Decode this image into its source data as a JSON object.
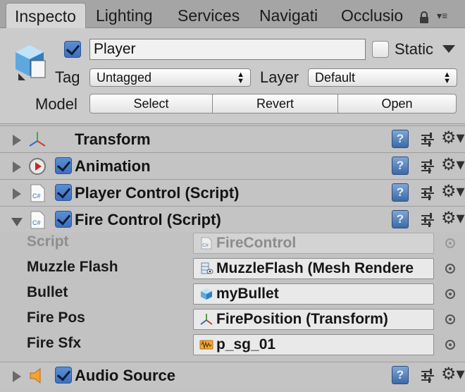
{
  "tabs": [
    {
      "label": "Inspecto",
      "active": true
    },
    {
      "label": "Lighting",
      "active": false
    },
    {
      "label": "Services",
      "active": false
    },
    {
      "label": "Navigati",
      "active": false
    },
    {
      "label": "Occlusio",
      "active": false
    }
  ],
  "header": {
    "active_checked": true,
    "name_value": "Player",
    "static_label": "Static",
    "static_checked": false,
    "tag_label": "Tag",
    "tag_value": "Untagged",
    "layer_label": "Layer",
    "layer_value": "Default",
    "model_label": "Model",
    "model_buttons": [
      "Select",
      "Revert",
      "Open"
    ]
  },
  "components": [
    {
      "title": "Transform",
      "icon": "transform-icon",
      "expanded": false,
      "has_checkbox": false
    },
    {
      "title": "Animation",
      "icon": "animation-icon",
      "expanded": false,
      "has_checkbox": true,
      "checked": true
    },
    {
      "title": "Player Control (Script)",
      "icon": "csharp-script-icon",
      "expanded": false,
      "has_checkbox": true,
      "checked": true
    },
    {
      "title": "Fire Control (Script)",
      "icon": "csharp-script-icon",
      "expanded": true,
      "has_checkbox": true,
      "checked": true
    },
    {
      "title": "Audio Source",
      "icon": "speaker-icon",
      "expanded": false,
      "has_checkbox": true,
      "checked": true
    }
  ],
  "fire_control_properties": [
    {
      "label": "Script",
      "value": "FireControl",
      "icon": "csharp-script-icon",
      "disabled": true
    },
    {
      "label": "Muzzle Flash",
      "value": "MuzzleFlash (Mesh Rendere",
      "icon": "mesh-renderer-icon",
      "disabled": false
    },
    {
      "label": "Bullet",
      "value": "myBullet",
      "icon": "prefab-cube-icon",
      "disabled": false
    },
    {
      "label": "Fire Pos",
      "value": "FirePosition (Transform)",
      "icon": "transform-icon",
      "disabled": false
    },
    {
      "label": "Fire Sfx",
      "value": "p_sg_01",
      "icon": "audio-clip-icon",
      "disabled": false
    }
  ],
  "colors": {
    "checkbox_blue": "#3d6fbd",
    "help_blue": "#3c6aa6",
    "panel_gray": "#c2c2c2"
  }
}
